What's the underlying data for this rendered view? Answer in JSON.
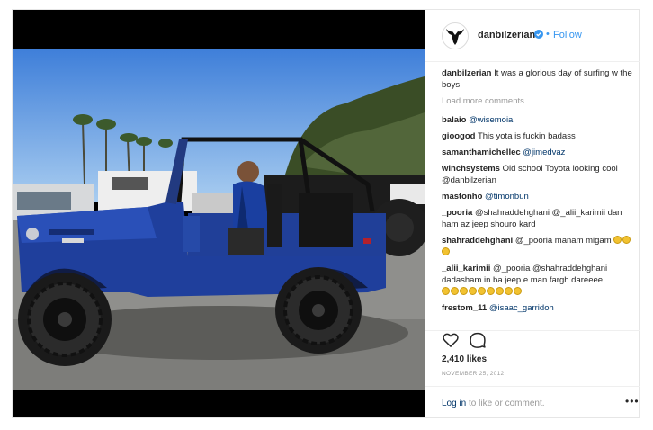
{
  "post": {
    "username": "danbilzerian",
    "follow_separator": "•",
    "follow_label": "Follow",
    "caption_user": "danbilzerian",
    "caption_text": "It was a glorious day of surfing w the boys",
    "load_more": "Load more comments",
    "comments": [
      {
        "user": "balaio",
        "text": "@wisemoia"
      },
      {
        "user": "gioogod",
        "text": "This yota is fuckin badass"
      },
      {
        "user": "samanthamichellec",
        "text": "@jimedvaz"
      },
      {
        "user": "winchsystems",
        "text": "Old school Toyota looking cool @danbilzerian"
      },
      {
        "user": "mastonho",
        "text": "@timonbun"
      },
      {
        "user": "_pooria",
        "text": "@shahraddehghani @_alii_karimii dan ham az jeep shouro kard"
      },
      {
        "user": "shahraddehghani",
        "text": "@_pooria manam migam"
      },
      {
        "user": "_alii_karimii",
        "text": "@_pooria @shahraddehghani dadasham in ba jeep e man fargh dareeee"
      },
      {
        "user": "frestom_11",
        "text": "@isaac_garridoh"
      }
    ],
    "likes": "2,410 likes",
    "date": "NOVEMBER 25, 2012",
    "login_link": "Log in",
    "login_rest": " to like or comment.",
    "more_menu": "•••"
  },
  "colors": {
    "accent": "#3897f0",
    "jeep": "#1f3f9c"
  },
  "icons": {
    "avatar": "goat-head-logo",
    "verified": "verified-badge-icon",
    "like": "heart-icon",
    "comment": "comment-bubble-icon"
  }
}
